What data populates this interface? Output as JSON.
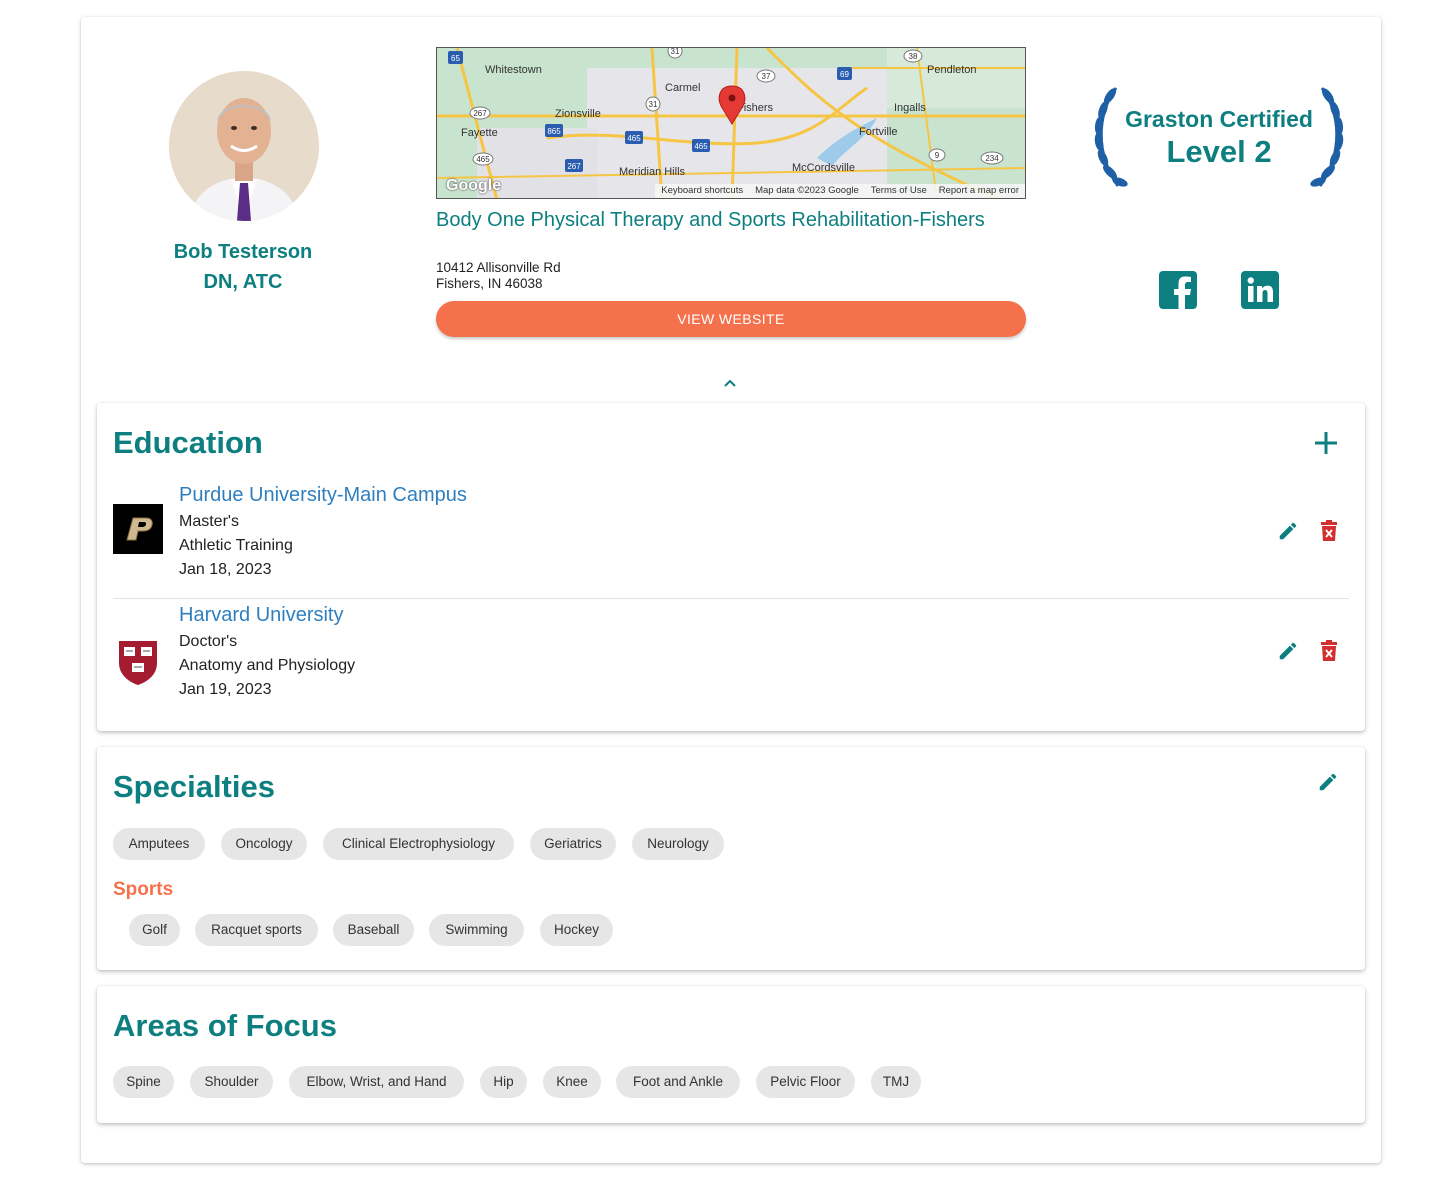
{
  "provider": {
    "name": "Bob Testerson",
    "credentials": "DN, ATC"
  },
  "map": {
    "place_labels": [
      "Whitestown",
      "Carmel",
      "Fishers",
      "Pendleton",
      "Zionsville",
      "Ingalls",
      "Fayette",
      "Fortville",
      "Meridian Hills",
      "McCordsville"
    ],
    "route_labels": [
      "65",
      "31",
      "38",
      "37",
      "69",
      "267",
      "31",
      "865",
      "465",
      "465",
      "267",
      "465",
      "9",
      "234"
    ],
    "google_logo": "Google",
    "footer": [
      "Keyboard shortcuts",
      "Map data ©2023 Google",
      "Terms of Use",
      "Report a map error"
    ]
  },
  "clinic": {
    "name": "Body One Physical Therapy and Sports Rehabilitation-Fishers",
    "address_line1": "10412 Allisonville Rd",
    "address_line2": "Fishers, IN 46038",
    "website_button": "VIEW WEBSITE"
  },
  "badge": {
    "line1": "Graston Certified",
    "line2": "Level 2"
  },
  "social": {
    "facebook_icon": "facebook-icon",
    "linkedin_icon": "linkedin-icon"
  },
  "education": {
    "title": "Education",
    "entries": [
      {
        "school": "Purdue University-Main Campus",
        "degree": "Master's",
        "field": "Athletic Training",
        "date": "Jan 18, 2023",
        "logo": "purdue-logo"
      },
      {
        "school": "Harvard University",
        "degree": "Doctor's",
        "field": "Anatomy and Physiology",
        "date": "Jan 19, 2023",
        "logo": "harvard-logo"
      }
    ]
  },
  "specialties": {
    "title": "Specialties",
    "items": [
      "Amputees",
      "Oncology",
      "Clinical Electrophysiology",
      "Geriatrics",
      "Neurology"
    ],
    "sports_title": "Sports",
    "sports": [
      "Golf",
      "Racquet sports",
      "Baseball",
      "Swimming",
      "Hockey"
    ]
  },
  "areas_of_focus": {
    "title": "Areas of Focus",
    "items": [
      "Spine",
      "Shoulder",
      "Elbow, Wrist, and Hand",
      "Hip",
      "Knee",
      "Foot and Ankle",
      "Pelvic Floor",
      "TMJ"
    ]
  },
  "colors": {
    "teal": "#0d7f80",
    "orange": "#f4714b",
    "link_blue": "#2f7fbf",
    "delete_red": "#d32f2f",
    "badge_blue": "#1f5fa6",
    "chip_gray": "#e6e6e6"
  }
}
